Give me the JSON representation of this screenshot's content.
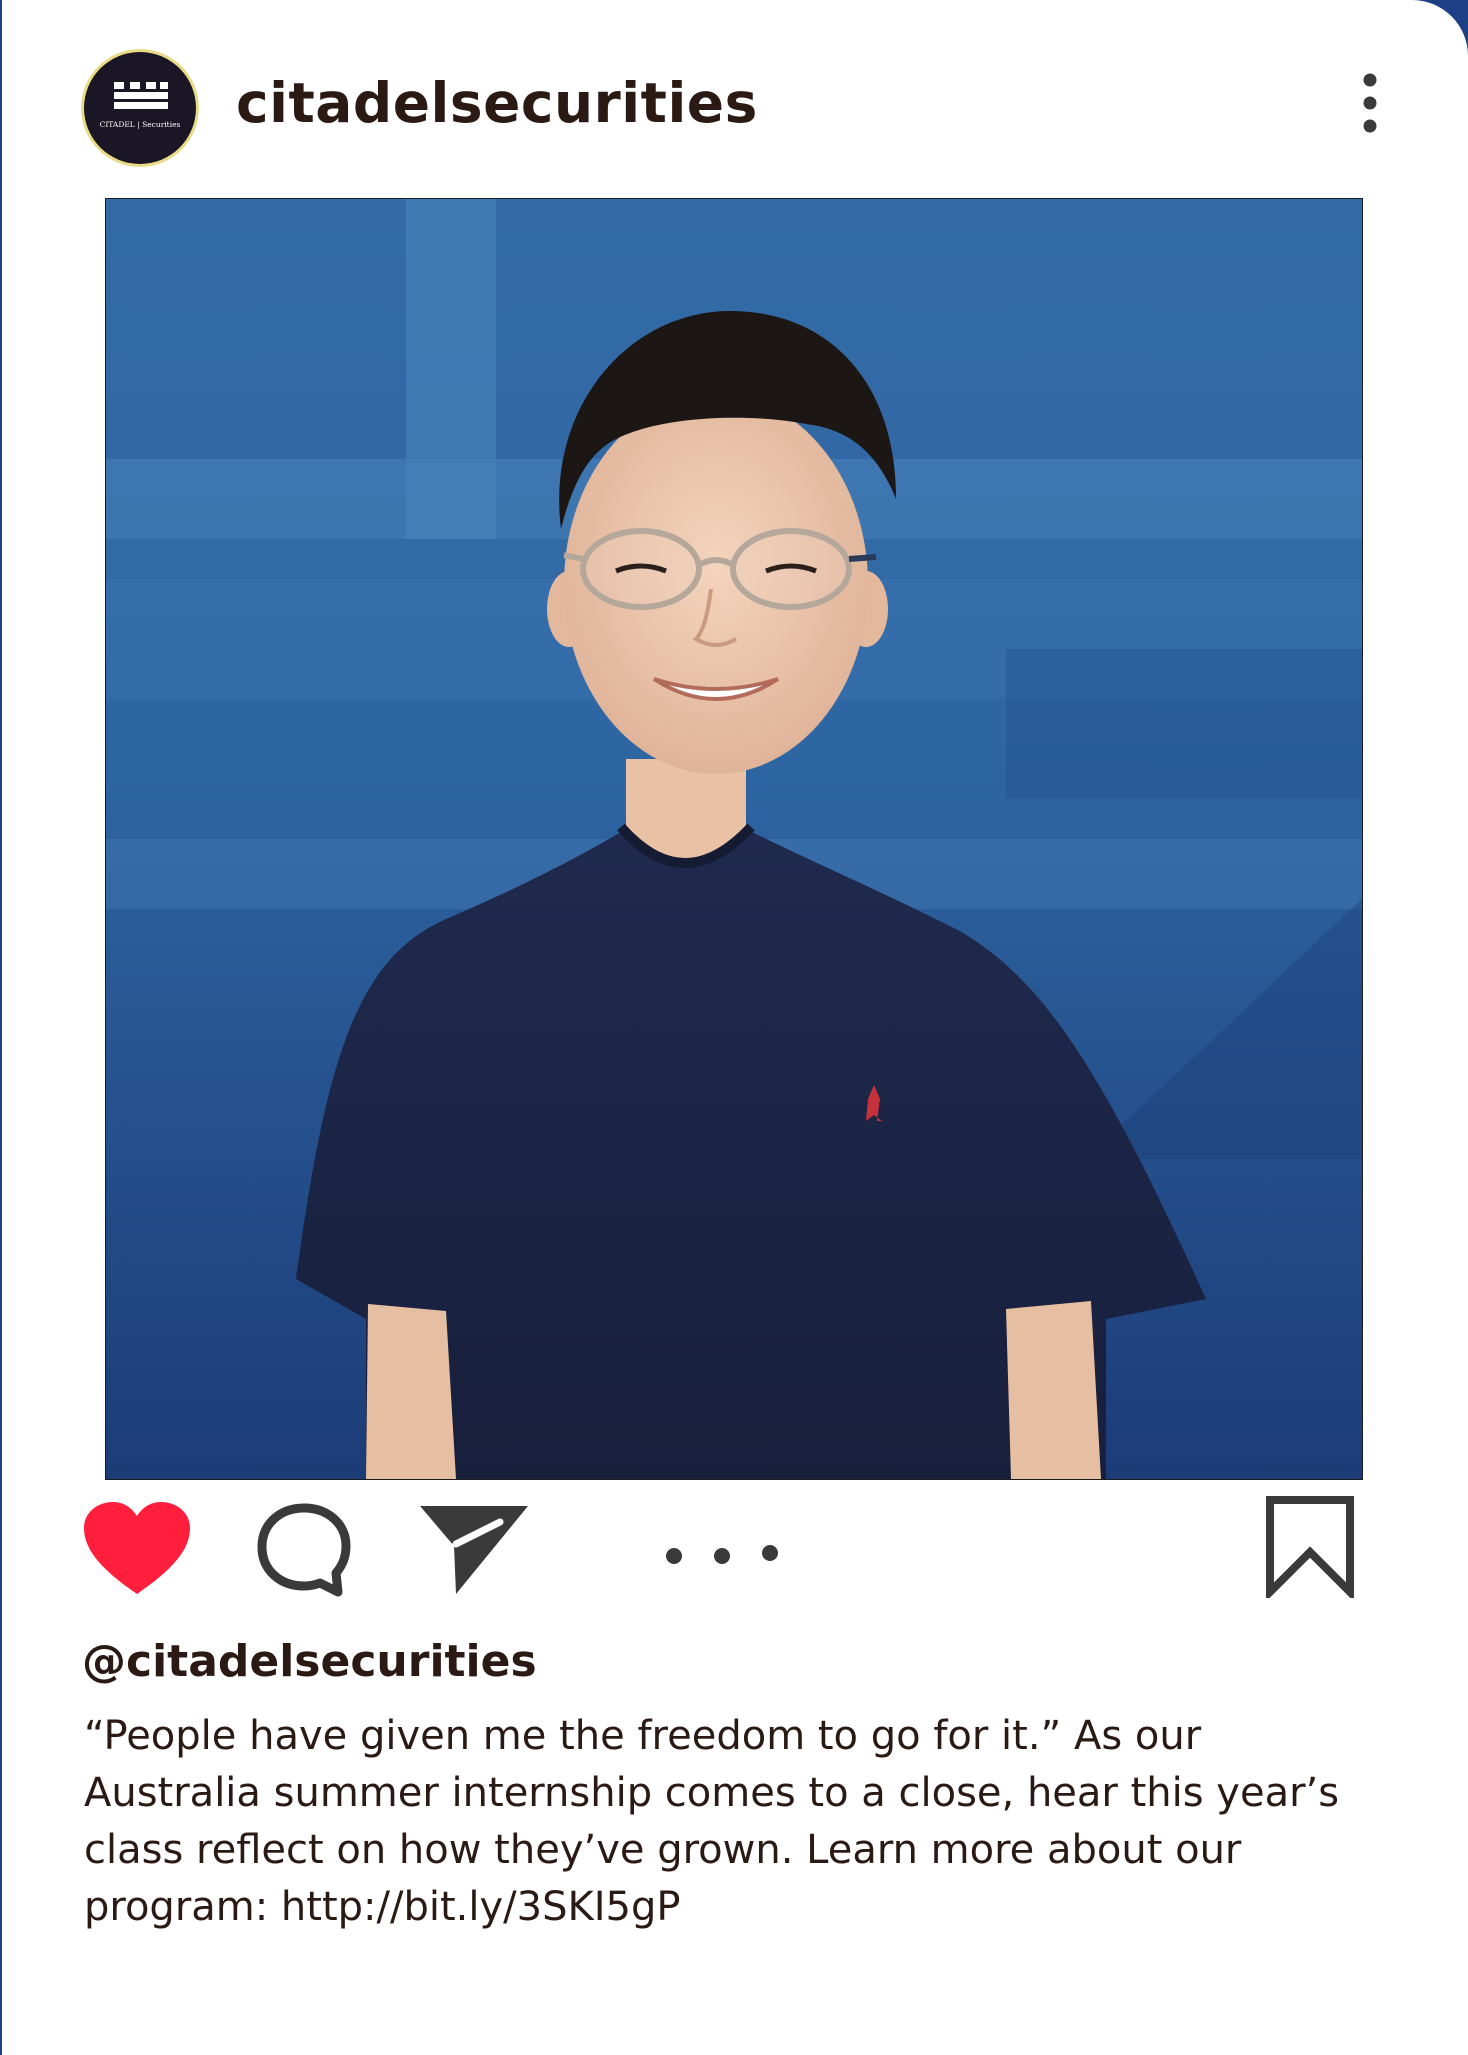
{
  "post": {
    "username": "citadelsecurities",
    "avatar_text": "CITADEL | Securities",
    "handle": "@citadelsecurities",
    "caption_lines": [
      "“People have given me the freedom to go for it.” As our",
      "Australia summer internship comes to a close, hear this year’s",
      "class reflect on how they’ve grown. Learn more about our",
      "program: http://bit.ly/3SKI5gP"
    ],
    "liked": true
  },
  "colors": {
    "frame": "#1d3f86",
    "text": "#2b1a14",
    "like": "#ff1f3d",
    "icon": "#3a3a3a",
    "photo_bg": "#2a5d98"
  },
  "icons": {
    "menu": "more-vertical-icon",
    "like": "heart-filled-icon",
    "comment": "speech-bubble-icon",
    "share": "paper-plane-icon",
    "more": "more-horizontal-icon",
    "save": "bookmark-icon"
  }
}
